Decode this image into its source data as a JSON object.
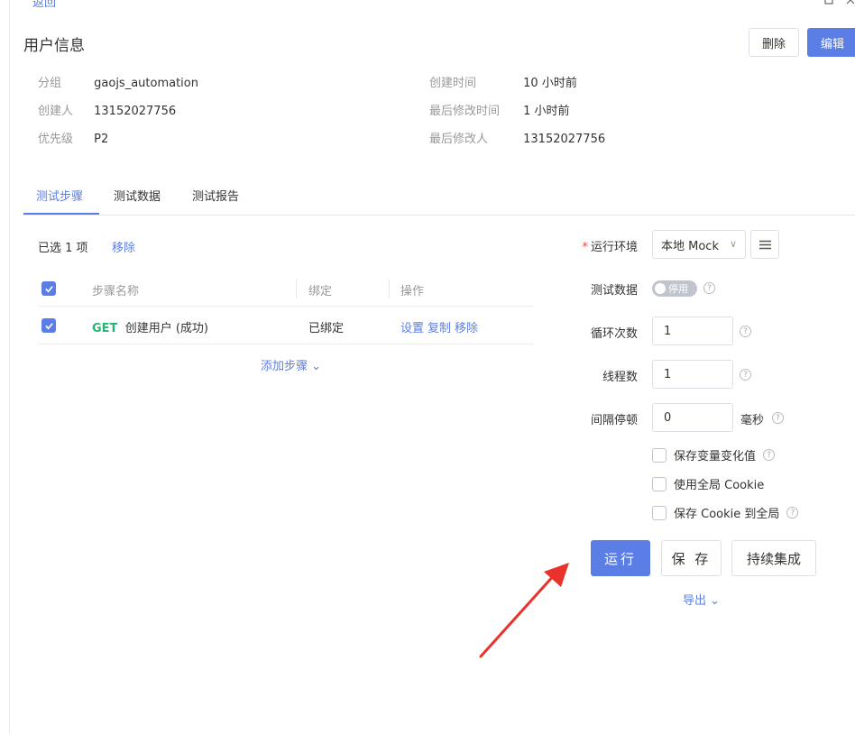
{
  "header": {
    "back_label": "返回",
    "title": "用户信息",
    "delete_label": "删除",
    "edit_label": "编辑"
  },
  "info": {
    "group_label": "分组",
    "group_value": "gaojs_automation",
    "creator_label": "创建人",
    "creator_value": "13152027756",
    "priority_label": "优先级",
    "priority_value": "P2",
    "created_label": "创建时间",
    "created_value": "10 小时前",
    "modified_label": "最后修改时间",
    "modified_value": "1 小时前",
    "modifier_label": "最后修改人",
    "modifier_value": "13152027756"
  },
  "tabs": [
    {
      "label": "测试步骤",
      "active": true
    },
    {
      "label": "测试数据",
      "active": false
    },
    {
      "label": "测试报告",
      "active": false
    }
  ],
  "steps": {
    "selected_text": "已选 1 项",
    "remove_label": "移除",
    "headers": {
      "name": "步骤名称",
      "bind": "绑定",
      "ops": "操作"
    },
    "rows": [
      {
        "method": "GET",
        "name": "创建用户 (成功)",
        "bind": "已绑定",
        "actions": [
          "设置",
          "复制",
          "移除"
        ]
      }
    ],
    "add_step_label": "添加步骤",
    "add_chevron": "⌄"
  },
  "run_form": {
    "env_label": "运行环境",
    "env_required_mark": "*",
    "env_value": "本地 Mock",
    "env_chevron": "∨",
    "test_data_label": "测试数据",
    "toggle_text": "停用",
    "toggle_on": false,
    "loops_label": "循环次数",
    "loops_value": "1",
    "threads_label": "线程数",
    "threads_value": "1",
    "interval_label": "间隔停顿",
    "interval_value": "0",
    "interval_unit": "毫秒",
    "options": [
      {
        "label": "保存变量变化值",
        "checked": false,
        "help": true
      },
      {
        "label": "使用全局 Cookie",
        "checked": false,
        "help": false
      },
      {
        "label": "保存 Cookie 到全局",
        "checked": false,
        "help": true
      }
    ]
  },
  "actions": {
    "run_label": "运行",
    "save_label": "保 存",
    "ci_label": "持续集成",
    "export_label": "导出",
    "export_chevron": "⌄"
  },
  "help_glyph": "?",
  "colors": {
    "accent": "#5b7ee6",
    "method_get": "#28b475",
    "annotation_arrow": "#e8322a"
  }
}
